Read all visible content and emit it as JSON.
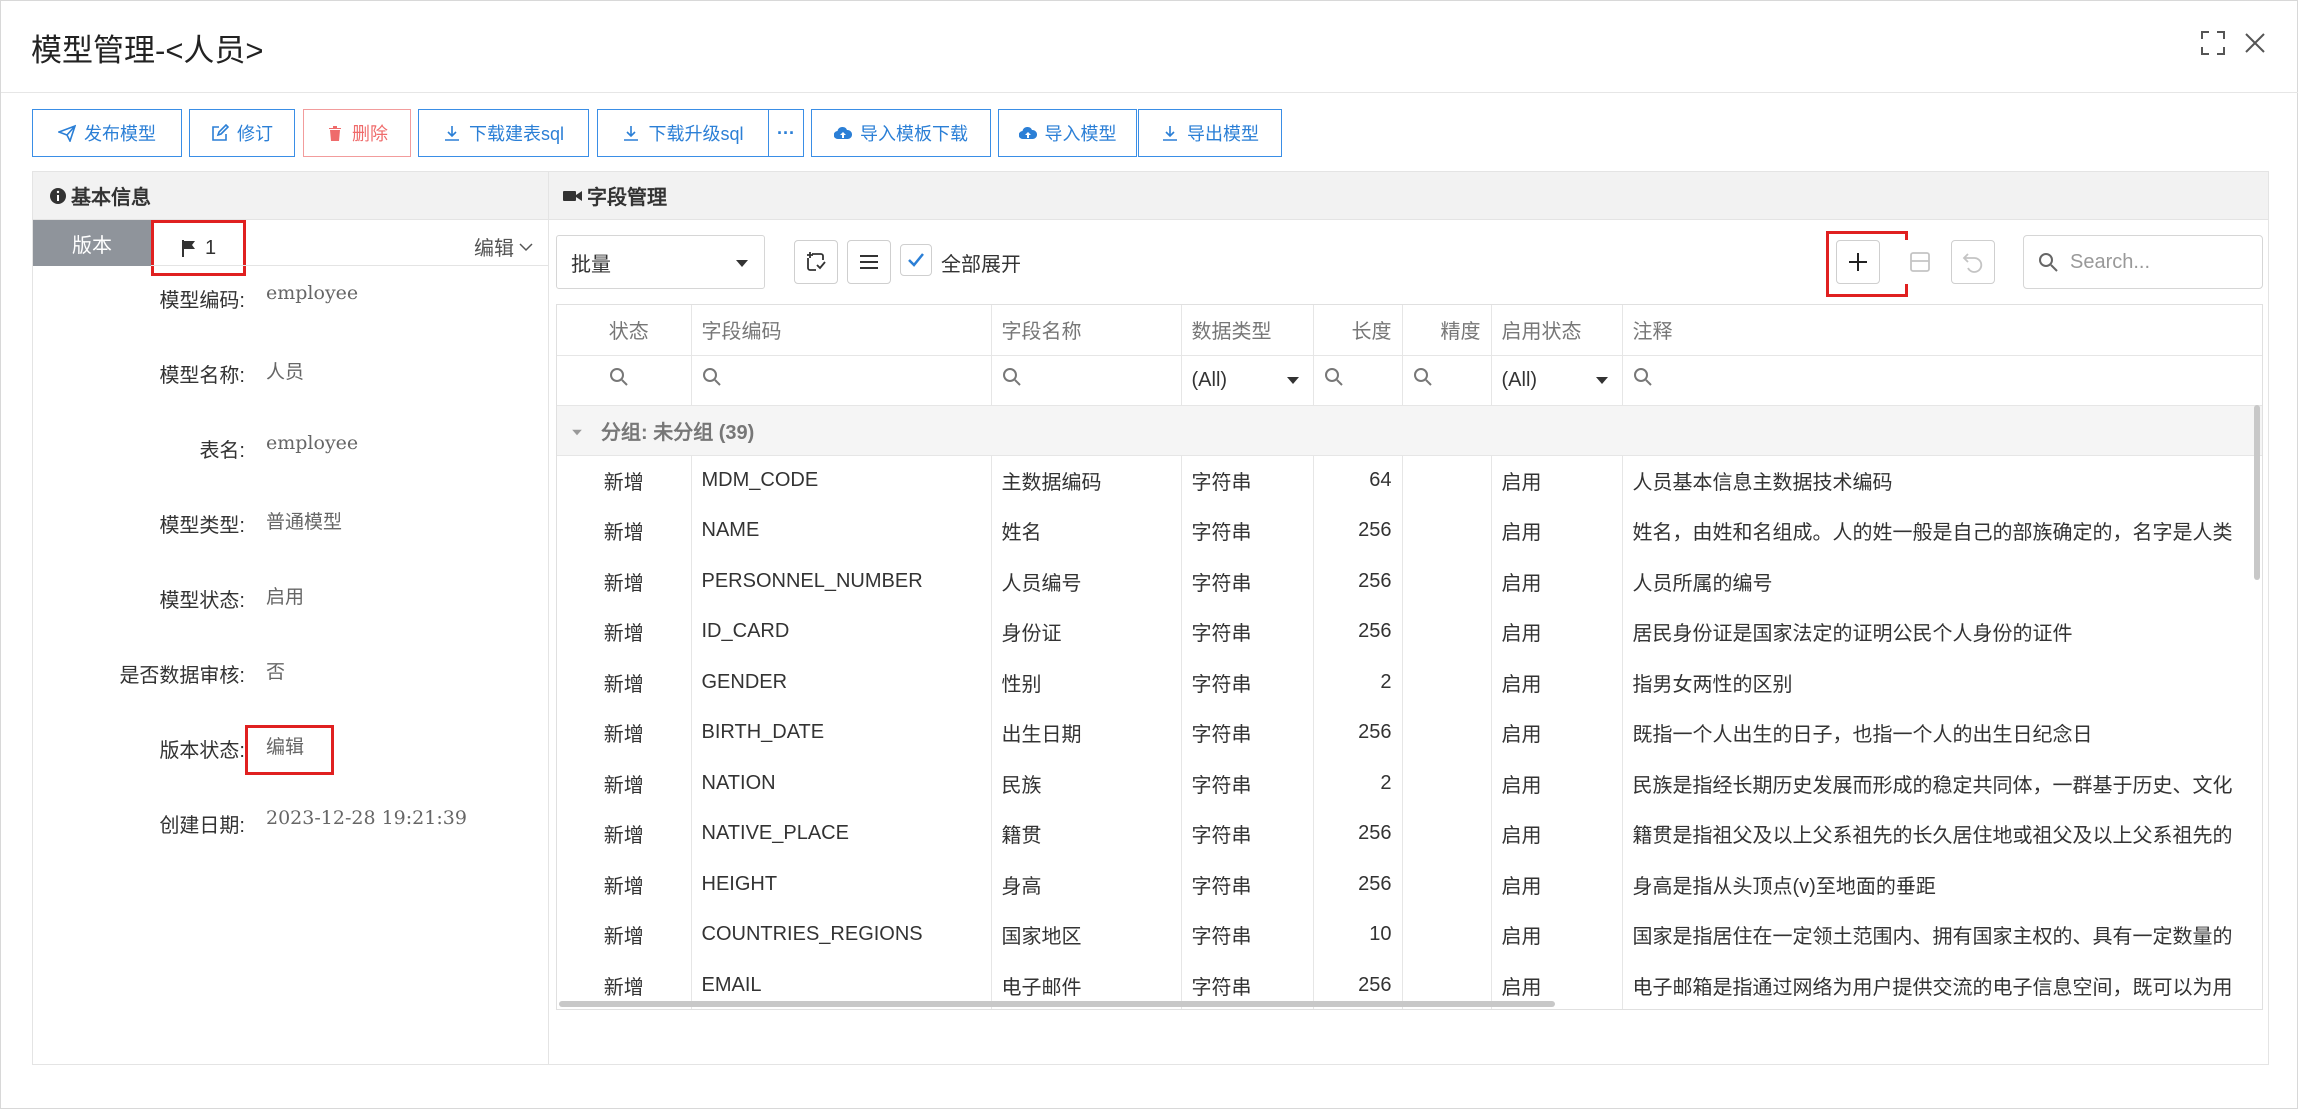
{
  "dialog": {
    "title": "模型管理-<人员>"
  },
  "toolbar": {
    "publish": "发布模型",
    "revise": "修订",
    "delete": "删除",
    "download_create_sql": "下载建表sql",
    "download_upgrade_sql": "下载升级sql",
    "more": "···",
    "import_template_download": "导入模板下载",
    "import_model": "导入模型",
    "export_model": "导出模型"
  },
  "basic_info": {
    "heading": "基本信息",
    "version_tab": "版本",
    "version_number": "1",
    "edit_dropdown": "编辑",
    "fields": [
      {
        "label": "模型编码:",
        "value": "employee"
      },
      {
        "label": "模型名称:",
        "value": "人员"
      },
      {
        "label": "表名:",
        "value": "employee"
      },
      {
        "label": "模型类型:",
        "value": "普通模型"
      },
      {
        "label": "模型状态:",
        "value": "启用"
      },
      {
        "label": "是否数据审核:",
        "value": "否"
      },
      {
        "label": "版本状态:",
        "value": "编辑"
      },
      {
        "label": "创建日期:",
        "value": "2023-12-28 19:21:39"
      }
    ]
  },
  "field_mgmt": {
    "heading": "字段管理",
    "batch_select": "批量",
    "expand_all_label": "全部展开",
    "expand_all_checked": true,
    "search_placeholder": "Search...",
    "columns": [
      "状态",
      "字段编码",
      "字段名称",
      "数据类型",
      "长度",
      "精度",
      "启用状态",
      "注释"
    ],
    "filter_all": "(All)",
    "group_label": "分组: 未分组 (39)",
    "rows": [
      {
        "status": "新增",
        "code": "MDM_CODE",
        "name": "主数据编码",
        "type": "字符串",
        "length": "64",
        "precision": "",
        "enabled": "启用",
        "comment": "人员基本信息主数据技术编码"
      },
      {
        "status": "新增",
        "code": "NAME",
        "name": "姓名",
        "type": "字符串",
        "length": "256",
        "precision": "",
        "enabled": "启用",
        "comment": "姓名，由姓和名组成。人的姓一般是自己的部族确定的，名字是人类"
      },
      {
        "status": "新增",
        "code": "PERSONNEL_NUMBER",
        "name": "人员编号",
        "type": "字符串",
        "length": "256",
        "precision": "",
        "enabled": "启用",
        "comment": "人员所属的编号"
      },
      {
        "status": "新增",
        "code": "ID_CARD",
        "name": "身份证",
        "type": "字符串",
        "length": "256",
        "precision": "",
        "enabled": "启用",
        "comment": "居民身份证是国家法定的证明公民个人身份的证件"
      },
      {
        "status": "新增",
        "code": "GENDER",
        "name": "性别",
        "type": "字符串",
        "length": "2",
        "precision": "",
        "enabled": "启用",
        "comment": "指男女两性的区别"
      },
      {
        "status": "新增",
        "code": "BIRTH_DATE",
        "name": "出生日期",
        "type": "字符串",
        "length": "256",
        "precision": "",
        "enabled": "启用",
        "comment": "既指一个人出生的日子，也指一个人的出生日纪念日"
      },
      {
        "status": "新增",
        "code": "NATION",
        "name": "民族",
        "type": "字符串",
        "length": "2",
        "precision": "",
        "enabled": "启用",
        "comment": "民族是指经长期历史发展而形成的稳定共同体，一群基于历史、文化"
      },
      {
        "status": "新增",
        "code": "NATIVE_PLACE",
        "name": "籍贯",
        "type": "字符串",
        "length": "256",
        "precision": "",
        "enabled": "启用",
        "comment": "籍贯是指祖父及以上父系祖先的长久居住地或祖父及以上父系祖先的"
      },
      {
        "status": "新增",
        "code": "HEIGHT",
        "name": "身高",
        "type": "字符串",
        "length": "256",
        "precision": "",
        "enabled": "启用",
        "comment": "身高是指从头顶点(v)至地面的垂距"
      },
      {
        "status": "新增",
        "code": "COUNTRIES_REGIONS",
        "name": "国家地区",
        "type": "字符串",
        "length": "10",
        "precision": "",
        "enabled": "启用",
        "comment": "国家是指居住在一定领土范围内、拥有国家主权的、具有一定数量的"
      },
      {
        "status": "新增",
        "code": "EMAIL",
        "name": "电子邮件",
        "type": "字符串",
        "length": "256",
        "precision": "",
        "enabled": "启用",
        "comment": "电子邮箱是指通过网络为用户提供交流的电子信息空间，既可以为用"
      }
    ]
  },
  "colors": {
    "primary": "#2b7fd6",
    "danger": "#ef6b6b",
    "highlight": "#e02020",
    "tab_gray": "#8f949b"
  }
}
